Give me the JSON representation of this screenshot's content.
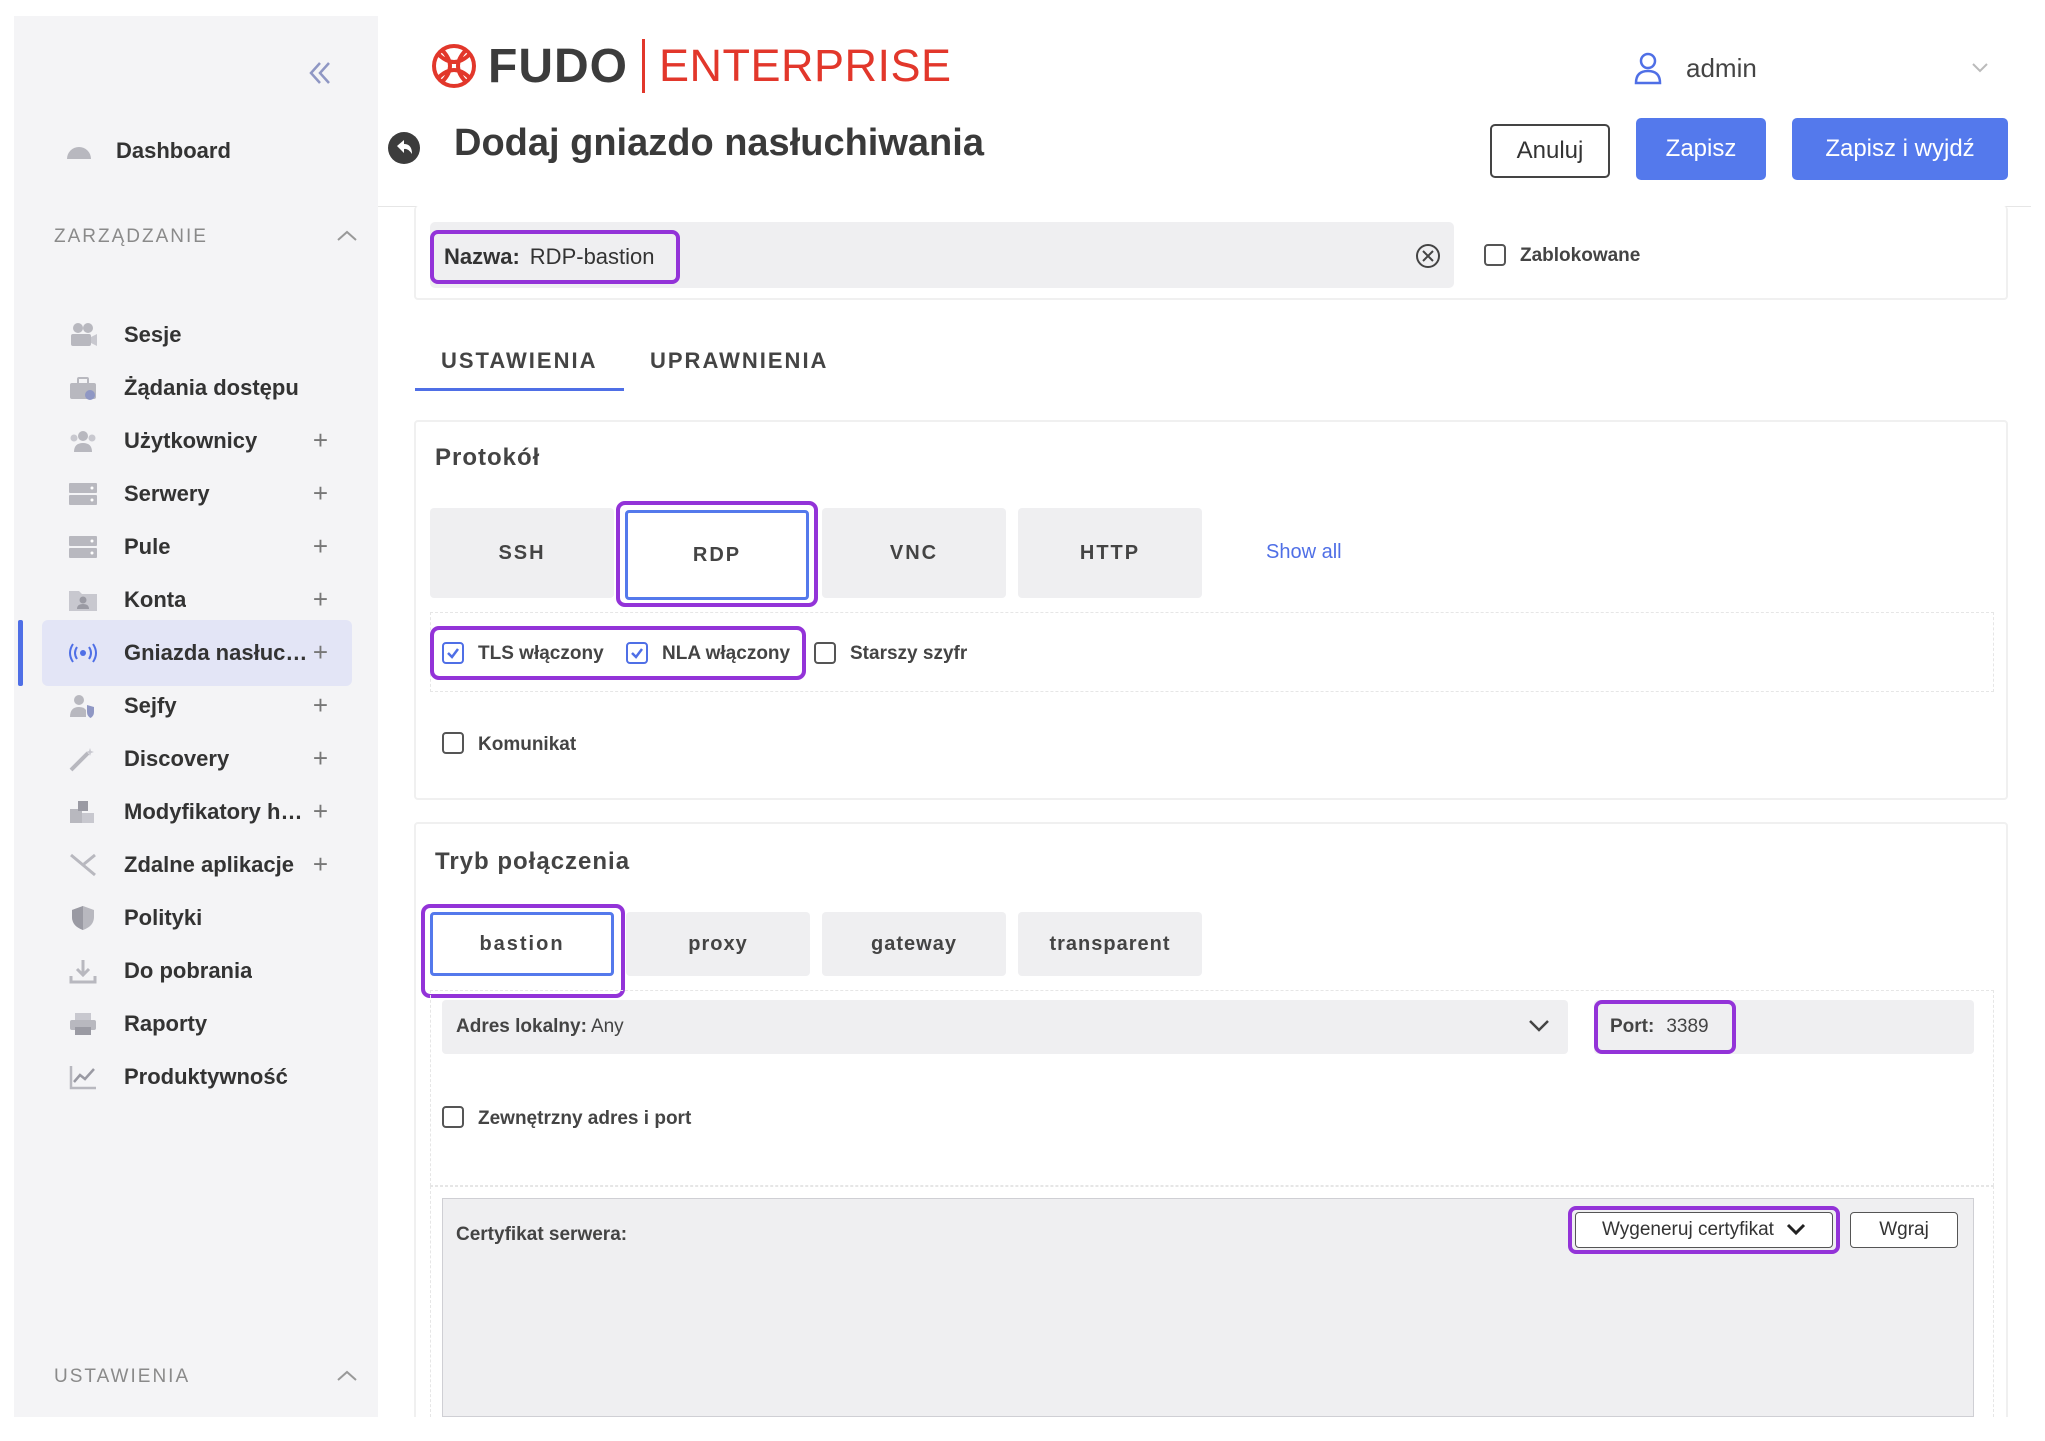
{
  "brand": {
    "name": "FUDO",
    "edition": "ENTERPRISE",
    "logo_color": "#e2372b"
  },
  "user": {
    "name": "admin"
  },
  "page": {
    "title": "Dodaj gniazdo nasłuchiwania"
  },
  "actions": {
    "cancel": "Anuluj",
    "save": "Zapisz",
    "save_exit": "Zapisz i wyjdź"
  },
  "sidebar": {
    "dashboard": "Dashboard",
    "section_management": "ZARZĄDZANIE",
    "items": [
      {
        "label": "Sesje",
        "icon": "camera-icon",
        "plus": false
      },
      {
        "label": "Żądania dostępu",
        "icon": "briefcase-icon",
        "plus": false
      },
      {
        "label": "Użytkownicy",
        "icon": "users-icon",
        "plus": true
      },
      {
        "label": "Serwery",
        "icon": "server-icon",
        "plus": true
      },
      {
        "label": "Pule",
        "icon": "pool-icon",
        "plus": true
      },
      {
        "label": "Konta",
        "icon": "account-folder-icon",
        "plus": true
      },
      {
        "label": "Gniazda nasłuchiwania",
        "icon": "broadcast-icon",
        "plus": true,
        "active": true
      },
      {
        "label": "Sejfy",
        "icon": "safe-icon",
        "plus": true
      },
      {
        "label": "Discovery",
        "icon": "magic-wand-icon",
        "plus": true
      },
      {
        "label": "Modyfikatory haseł",
        "icon": "puzzle-icon",
        "plus": true
      },
      {
        "label": "Zdalne aplikacje",
        "icon": "remote-app-icon",
        "plus": true
      },
      {
        "label": "Polityki",
        "icon": "shield-icon",
        "plus": false
      },
      {
        "label": "Do pobrania",
        "icon": "download-icon",
        "plus": false
      },
      {
        "label": "Raporty",
        "icon": "printer-icon",
        "plus": false
      },
      {
        "label": "Produktywność",
        "icon": "chart-icon",
        "plus": false
      }
    ],
    "section_settings": "USTAWIENIA",
    "accent": "#4f6fe6"
  },
  "form": {
    "name_label": "Nazwa:",
    "name_value": "RDP-bastion",
    "blocked_label": "Zablokowane",
    "blocked_checked": false,
    "tabs": [
      "USTAWIENIA",
      "UPRAWNIENIA"
    ],
    "active_tab": "USTAWIENIA",
    "protocol": {
      "title": "Protokół",
      "options": [
        "SSH",
        "RDP",
        "VNC",
        "HTTP"
      ],
      "selected": "RDP",
      "show_all": "Show all",
      "tls_label": "TLS włączony",
      "tls_checked": true,
      "nla_label": "NLA włączony",
      "nla_checked": true,
      "legacy_label": "Starszy szyfr",
      "legacy_checked": false,
      "message_label": "Komunikat",
      "message_checked": false
    },
    "connection": {
      "title": "Tryb połączenia",
      "options": [
        "bastion",
        "proxy",
        "gateway",
        "transparent"
      ],
      "selected": "bastion",
      "local_address_label": "Adres lokalny:",
      "local_address_value": "Any",
      "port_label": "Port:",
      "port_value": "3389",
      "external_label": "Zewnętrzny adres i port",
      "external_checked": false
    },
    "certificate": {
      "label": "Certyfikat serwera:",
      "generate": "Wygeneruj certyfikat",
      "upload": "Wgraj"
    }
  },
  "highlight_color": "#9333d8"
}
